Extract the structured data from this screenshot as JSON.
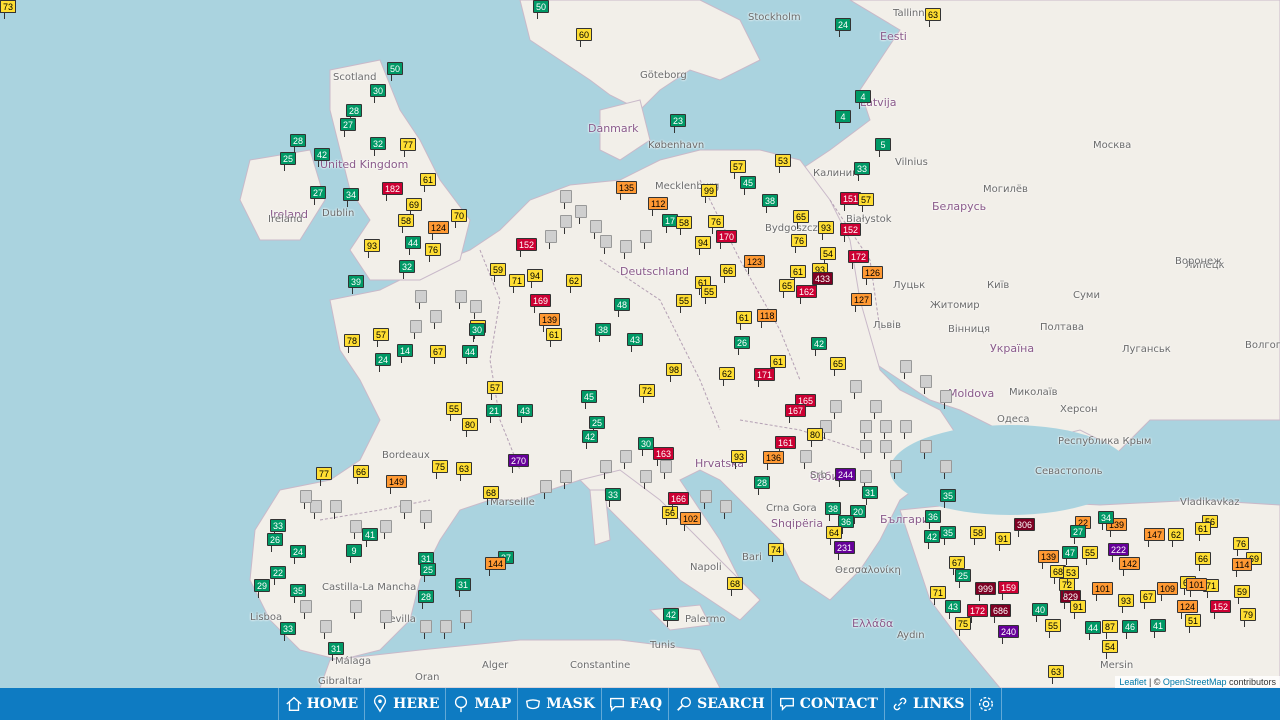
{
  "places": [
    {
      "text": "Stockholm",
      "cls": "place"
    },
    {
      "text": "Tallinn",
      "cls": "place"
    },
    {
      "text": "Eesti",
      "cls": "place country"
    },
    {
      "text": "Göteborg",
      "cls": "place"
    },
    {
      "text": "Latvija",
      "cls": "place country"
    },
    {
      "text": "Danmark",
      "cls": "place country"
    },
    {
      "text": "København",
      "cls": "place"
    },
    {
      "text": "Москва",
      "cls": "place"
    },
    {
      "text": "Scotland",
      "cls": "place"
    },
    {
      "text": "United Kingdom",
      "cls": "place country"
    },
    {
      "text": "Ireland",
      "cls": "place country"
    },
    {
      "text": "Dublin",
      "cls": "place"
    },
    {
      "text": "Беларусь",
      "cls": "place country"
    },
    {
      "text": "Могилёв",
      "cls": "place"
    },
    {
      "text": "Białystok",
      "cls": "place"
    },
    {
      "text": "Калинин",
      "cls": "place"
    },
    {
      "text": "Vilnius",
      "cls": "place"
    },
    {
      "text": "Deutschland",
      "cls": "place country"
    },
    {
      "text": "Липецк",
      "cls": "place"
    },
    {
      "text": "Воронеж",
      "cls": "place"
    },
    {
      "text": "Луцьк",
      "cls": "place"
    },
    {
      "text": "Житомир",
      "cls": "place"
    },
    {
      "text": "Київ",
      "cls": "place"
    },
    {
      "text": "Суми",
      "cls": "place"
    },
    {
      "text": "Львів",
      "cls": "place"
    },
    {
      "text": "Вінниця",
      "cls": "place"
    },
    {
      "text": "Полтава",
      "cls": "place"
    },
    {
      "text": "Україна",
      "cls": "place country"
    },
    {
      "text": "Луганськ",
      "cls": "place"
    },
    {
      "text": "Волгоград",
      "cls": "place"
    },
    {
      "text": "Moldova",
      "cls": "place country"
    },
    {
      "text": "Миколаїв",
      "cls": "place"
    },
    {
      "text": "Одеса",
      "cls": "place"
    },
    {
      "text": "Херсон",
      "cls": "place"
    },
    {
      "text": "Севастополь",
      "cls": "place"
    },
    {
      "text": "Республика Крым",
      "cls": "place"
    },
    {
      "text": "Bordeaux",
      "cls": "place"
    },
    {
      "text": "Marseille",
      "cls": "place"
    },
    {
      "text": "Hrvatska",
      "cls": "place country"
    },
    {
      "text": "Србија",
      "cls": "place country"
    },
    {
      "text": "Crna Gora",
      "cls": "place"
    },
    {
      "text": "Shqipëria",
      "cls": "place country"
    },
    {
      "text": "България",
      "cls": "place country"
    },
    {
      "text": "Vladikavkaz",
      "cls": "place"
    },
    {
      "text": "Θεσσαλονίκη",
      "cls": "place"
    },
    {
      "text": "Ελλάδα",
      "cls": "place country"
    },
    {
      "text": "Napoli",
      "cls": "place"
    },
    {
      "text": "Bari",
      "cls": "place"
    },
    {
      "text": "Palermo",
      "cls": "place"
    },
    {
      "text": "Lisboa",
      "cls": "place"
    },
    {
      "text": "Castilla-La Mancha",
      "cls": "place"
    },
    {
      "text": "Málaga",
      "cls": "place"
    },
    {
      "text": "Oran",
      "cls": "place"
    },
    {
      "text": "Alger",
      "cls": "place"
    },
    {
      "text": "Constantine",
      "cls": "place"
    },
    {
      "text": "Tunis",
      "cls": "place"
    },
    {
      "text": "Gibraltar",
      "cls": "place"
    },
    {
      "text": "Aydın",
      "cls": "place"
    },
    {
      "text": "Mersin",
      "cls": "place"
    },
    {
      "text": "Ireland",
      "cls": "place"
    },
    {
      "text": "Mecklenburg",
      "cls": "place"
    },
    {
      "text": "Bydgoszcz",
      "cls": "place"
    },
    {
      "text": "Srb",
      "cls": "place"
    },
    {
      "text": "Sevilla",
      "cls": "place"
    }
  ],
  "markers": [
    {
      "v": "50",
      "c": "good"
    },
    {
      "v": "60",
      "c": "mod"
    },
    {
      "v": "24",
      "c": "good"
    },
    {
      "v": "63",
      "c": "mod"
    },
    {
      "v": "50",
      "c": "good"
    },
    {
      "v": "30",
      "c": "good"
    },
    {
      "v": "28",
      "c": "good"
    },
    {
      "v": "27",
      "c": "good"
    },
    {
      "v": "32",
      "c": "good"
    },
    {
      "v": "77",
      "c": "mod"
    },
    {
      "v": "28",
      "c": "good"
    },
    {
      "v": "42",
      "c": "good"
    },
    {
      "v": "25",
      "c": "good"
    },
    {
      "v": "27",
      "c": "good"
    },
    {
      "v": "34",
      "c": "good"
    },
    {
      "v": "182",
      "c": "bad"
    },
    {
      "v": "61",
      "c": "mod"
    },
    {
      "v": "69",
      "c": "mod"
    },
    {
      "v": "70",
      "c": "mod"
    },
    {
      "v": "58",
      "c": "mod"
    },
    {
      "v": "124",
      "c": "usg"
    },
    {
      "v": "93",
      "c": "mod"
    },
    {
      "v": "76",
      "c": "mod"
    },
    {
      "v": "44",
      "c": "good"
    },
    {
      "v": "32",
      "c": "good"
    },
    {
      "v": "39",
      "c": "good"
    },
    {
      "v": "23",
      "c": "good"
    },
    {
      "v": "4",
      "c": "good"
    },
    {
      "v": "4",
      "c": "good"
    },
    {
      "v": "5",
      "c": "good"
    },
    {
      "v": "57",
      "c": "mod"
    },
    {
      "v": "53",
      "c": "mod"
    },
    {
      "v": "45",
      "c": "good"
    },
    {
      "v": "33",
      "c": "good"
    },
    {
      "v": "99",
      "c": "mod"
    },
    {
      "v": "135",
      "c": "usg"
    },
    {
      "v": "38",
      "c": "good"
    },
    {
      "v": "151",
      "c": "bad"
    },
    {
      "v": "57",
      "c": "mod"
    },
    {
      "v": "112",
      "c": "usg"
    },
    {
      "v": "17",
      "c": "good"
    },
    {
      "v": "58",
      "c": "mod"
    },
    {
      "v": "76",
      "c": "mod"
    },
    {
      "v": "65",
      "c": "mod"
    },
    {
      "v": "93",
      "c": "mod"
    },
    {
      "v": "152",
      "c": "bad"
    },
    {
      "v": "170",
      "c": "bad"
    },
    {
      "v": "94",
      "c": "mod"
    },
    {
      "v": "76",
      "c": "mod"
    },
    {
      "v": "54",
      "c": "mod"
    },
    {
      "v": "172",
      "c": "bad"
    },
    {
      "v": "152",
      "c": "bad"
    },
    {
      "v": "59",
      "c": "mod"
    },
    {
      "v": "94",
      "c": "mod"
    },
    {
      "v": "123",
      "c": "usg"
    },
    {
      "v": "66",
      "c": "mod"
    },
    {
      "v": "61",
      "c": "mod"
    },
    {
      "v": "93",
      "c": "mod"
    },
    {
      "v": "126",
      "c": "usg"
    },
    {
      "v": "71",
      "c": "mod"
    },
    {
      "v": "62",
      "c": "mod"
    },
    {
      "v": "61",
      "c": "mod"
    },
    {
      "v": "55",
      "c": "mod"
    },
    {
      "v": "65",
      "c": "mod"
    },
    {
      "v": "162",
      "c": "bad"
    },
    {
      "v": "433",
      "c": "haz"
    },
    {
      "v": "127",
      "c": "usg"
    },
    {
      "v": "169",
      "c": "bad"
    },
    {
      "v": "48",
      "c": "good"
    },
    {
      "v": "55",
      "c": "mod"
    },
    {
      "v": "61",
      "c": "mod"
    },
    {
      "v": "118",
      "c": "usg"
    },
    {
      "v": "139",
      "c": "usg"
    },
    {
      "v": "53",
      "c": "mod"
    },
    {
      "v": "61",
      "c": "mod"
    },
    {
      "v": "57",
      "c": "mod"
    },
    {
      "v": "78",
      "c": "mod"
    },
    {
      "v": "24",
      "c": "good"
    },
    {
      "v": "14",
      "c": "good"
    },
    {
      "v": "67",
      "c": "mod"
    },
    {
      "v": "44",
      "c": "good"
    },
    {
      "v": "38",
      "c": "good"
    },
    {
      "v": "43",
      "c": "good"
    },
    {
      "v": "30",
      "c": "good"
    },
    {
      "v": "26",
      "c": "good"
    },
    {
      "v": "42",
      "c": "good"
    },
    {
      "v": "61",
      "c": "mod"
    },
    {
      "v": "65",
      "c": "mod"
    },
    {
      "v": "171",
      "c": "bad"
    },
    {
      "v": "98",
      "c": "mod"
    },
    {
      "v": "62",
      "c": "mod"
    },
    {
      "v": "72",
      "c": "mod"
    },
    {
      "v": "57",
      "c": "mod"
    },
    {
      "v": "55",
      "c": "mod"
    },
    {
      "v": "80",
      "c": "mod"
    },
    {
      "v": "21",
      "c": "good"
    },
    {
      "v": "43",
      "c": "good"
    },
    {
      "v": "45",
      "c": "good"
    },
    {
      "v": "25",
      "c": "good"
    },
    {
      "v": "42",
      "c": "good"
    },
    {
      "v": "30",
      "c": "good"
    },
    {
      "v": "163",
      "c": "bad"
    },
    {
      "v": "165",
      "c": "bad"
    },
    {
      "v": "167",
      "c": "bad"
    },
    {
      "v": "161",
      "c": "bad"
    },
    {
      "v": "136",
      "c": "usg"
    },
    {
      "v": "80",
      "c": "mod"
    },
    {
      "v": "244",
      "c": "vbad"
    },
    {
      "v": "270",
      "c": "vbad"
    },
    {
      "v": "77",
      "c": "mod"
    },
    {
      "v": "66",
      "c": "mod"
    },
    {
      "v": "149",
      "c": "usg"
    },
    {
      "v": "75",
      "c": "mod"
    },
    {
      "v": "63",
      "c": "mod"
    },
    {
      "v": "68",
      "c": "mod"
    },
    {
      "v": "93",
      "c": "mod"
    },
    {
      "v": "28",
      "c": "good"
    },
    {
      "v": "31",
      "c": "good"
    },
    {
      "v": "38",
      "c": "good"
    },
    {
      "v": "20",
      "c": "good"
    },
    {
      "v": "36",
      "c": "good"
    },
    {
      "v": "64",
      "c": "mod"
    },
    {
      "v": "231",
      "c": "vbad"
    },
    {
      "v": "56",
      "c": "mod"
    },
    {
      "v": "102",
      "c": "usg"
    },
    {
      "v": "166",
      "c": "bad"
    },
    {
      "v": "33",
      "c": "good"
    },
    {
      "v": "74",
      "c": "mod"
    },
    {
      "v": "68",
      "c": "mod"
    },
    {
      "v": "42",
      "c": "good"
    },
    {
      "v": "33",
      "c": "good"
    },
    {
      "v": "26",
      "c": "good"
    },
    {
      "v": "24",
      "c": "good"
    },
    {
      "v": "41",
      "c": "good"
    },
    {
      "v": "9",
      "c": "good"
    },
    {
      "v": "22",
      "c": "good"
    },
    {
      "v": "29",
      "c": "good"
    },
    {
      "v": "35",
      "c": "good"
    },
    {
      "v": "33",
      "c": "good"
    },
    {
      "v": "31",
      "c": "good"
    },
    {
      "v": "31",
      "c": "good"
    },
    {
      "v": "25",
      "c": "good"
    },
    {
      "v": "28",
      "c": "good"
    },
    {
      "v": "31",
      "c": "good"
    },
    {
      "v": "37",
      "c": "good"
    },
    {
      "v": "144",
      "c": "usg"
    },
    {
      "v": "35",
      "c": "good"
    },
    {
      "v": "36",
      "c": "good"
    },
    {
      "v": "42",
      "c": "good"
    },
    {
      "v": "35",
      "c": "good"
    },
    {
      "v": "58",
      "c": "mod"
    },
    {
      "v": "91",
      "c": "mod"
    },
    {
      "v": "306",
      "c": "haz"
    },
    {
      "v": "22",
      "c": "usg"
    },
    {
      "v": "139",
      "c": "usg"
    },
    {
      "v": "147",
      "c": "usg"
    },
    {
      "v": "62",
      "c": "mod"
    },
    {
      "v": "56",
      "c": "mod"
    },
    {
      "v": "76",
      "c": "mod"
    },
    {
      "v": "139",
      "c": "usg"
    },
    {
      "v": "222",
      "c": "vbad"
    },
    {
      "v": "142",
      "c": "usg"
    },
    {
      "v": "66",
      "c": "mod"
    },
    {
      "v": "69",
      "c": "mod"
    },
    {
      "v": "114",
      "c": "usg"
    },
    {
      "v": "999",
      "c": "haz"
    },
    {
      "v": "159",
      "c": "bad"
    },
    {
      "v": "172",
      "c": "bad"
    },
    {
      "v": "686",
      "c": "haz"
    },
    {
      "v": "75",
      "c": "mod"
    },
    {
      "v": "829",
      "c": "haz"
    },
    {
      "v": "91",
      "c": "mod"
    },
    {
      "v": "101",
      "c": "usg"
    },
    {
      "v": "93",
      "c": "mod"
    },
    {
      "v": "67",
      "c": "mod"
    },
    {
      "v": "109",
      "c": "usg"
    },
    {
      "v": "61",
      "c": "mod"
    },
    {
      "v": "71",
      "c": "mod"
    },
    {
      "v": "124",
      "c": "usg"
    },
    {
      "v": "152",
      "c": "bad"
    },
    {
      "v": "59",
      "c": "mod"
    },
    {
      "v": "51",
      "c": "mod"
    },
    {
      "v": "79",
      "c": "mod"
    },
    {
      "v": "40",
      "c": "good"
    },
    {
      "v": "55",
      "c": "mod"
    },
    {
      "v": "44",
      "c": "good"
    },
    {
      "v": "87",
      "c": "mod"
    },
    {
      "v": "46",
      "c": "good"
    },
    {
      "v": "41",
      "c": "good"
    },
    {
      "v": "54",
      "c": "mod"
    },
    {
      "v": "240",
      "c": "vbad"
    },
    {
      "v": "63",
      "c": "mod"
    },
    {
      "v": "71",
      "c": "mod"
    },
    {
      "v": "43",
      "c": "good"
    },
    {
      "v": "67",
      "c": "mod"
    },
    {
      "v": "101",
      "c": "usg"
    },
    {
      "v": "68",
      "c": "mod"
    },
    {
      "v": "72",
      "c": "mod"
    },
    {
      "v": "61",
      "c": "mod"
    },
    {
      "v": "53",
      "c": "mod"
    },
    {
      "v": "55",
      "c": "mod"
    },
    {
      "v": "34",
      "c": "good"
    },
    {
      "v": "47",
      "c": "good"
    },
    {
      "v": "27",
      "c": "good"
    },
    {
      "v": "25",
      "c": "good"
    },
    {
      "v": "18",
      "c": "good"
    },
    {
      "v": "12",
      "c": "good"
    },
    {
      "v": "26",
      "c": "good"
    },
    {
      "v": "42",
      "c": "good"
    },
    {
      "v": "73",
      "c": "mod"
    }
  ],
  "attribution": {
    "leaflet": "Leaflet",
    "sep": " | © ",
    "osm": "OpenStreetMap",
    "rest": " contributors"
  },
  "nav": [
    {
      "label": "HOME",
      "icon": "home-icon"
    },
    {
      "label": "HERE",
      "icon": "location-pin-icon"
    },
    {
      "label": "MAP",
      "icon": "map-pin-icon"
    },
    {
      "label": "MASK",
      "icon": "mask-icon"
    },
    {
      "label": "FAQ",
      "icon": "chat-bubble-icon"
    },
    {
      "label": "SEARCH",
      "icon": "search-icon"
    },
    {
      "label": "CONTACT",
      "icon": "contact-icon"
    },
    {
      "label": "LINKS",
      "icon": "link-icon"
    },
    {
      "label": "",
      "icon": "gear-icon"
    }
  ],
  "colors": {
    "good": "#009966",
    "moderate": "#ffde33",
    "usg": "#ff9933",
    "unhealthy": "#cc0033",
    "very_unhealthy": "#660099",
    "hazardous": "#7e0023",
    "nav": "#0e7bc2",
    "water": "#aad3df",
    "land": "#f2efe9"
  }
}
